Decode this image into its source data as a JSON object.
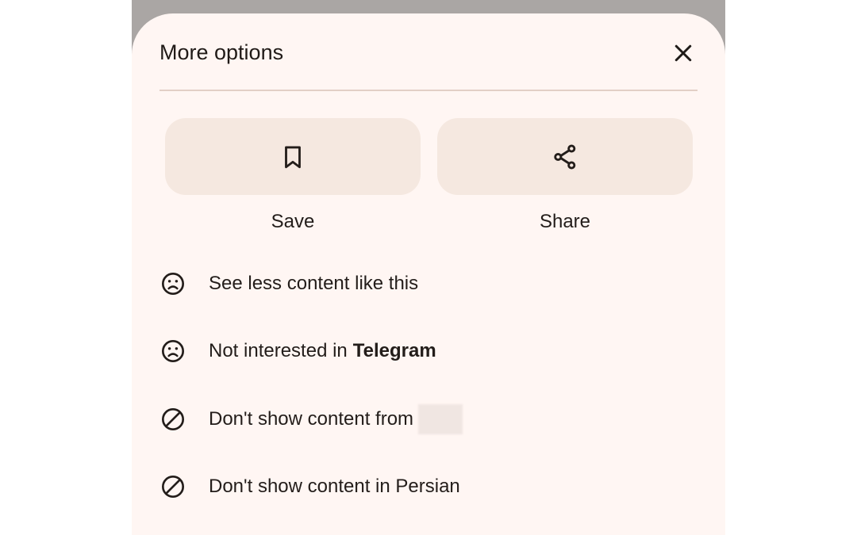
{
  "sheet": {
    "title": "More options"
  },
  "actions": [
    {
      "label": "Save",
      "icon": "bookmark-icon"
    },
    {
      "label": "Share",
      "icon": "share-icon"
    }
  ],
  "menu": {
    "see_less": {
      "label": "See less content like this",
      "icon": "sad-face-icon"
    },
    "not_interested": {
      "label": "Not interested in",
      "topic": "Telegram",
      "icon": "sad-face-icon"
    },
    "dont_show_from": {
      "label": "Don't show content from",
      "icon": "block-icon"
    },
    "dont_show_language": {
      "label": "Don't show content in Persian",
      "icon": "block-icon"
    }
  },
  "colors": {
    "sheet_background": "#fff6f3",
    "action_background": "#f5e8e0",
    "divider": "#e2cfc6",
    "scrim": "#aaa6a4"
  }
}
